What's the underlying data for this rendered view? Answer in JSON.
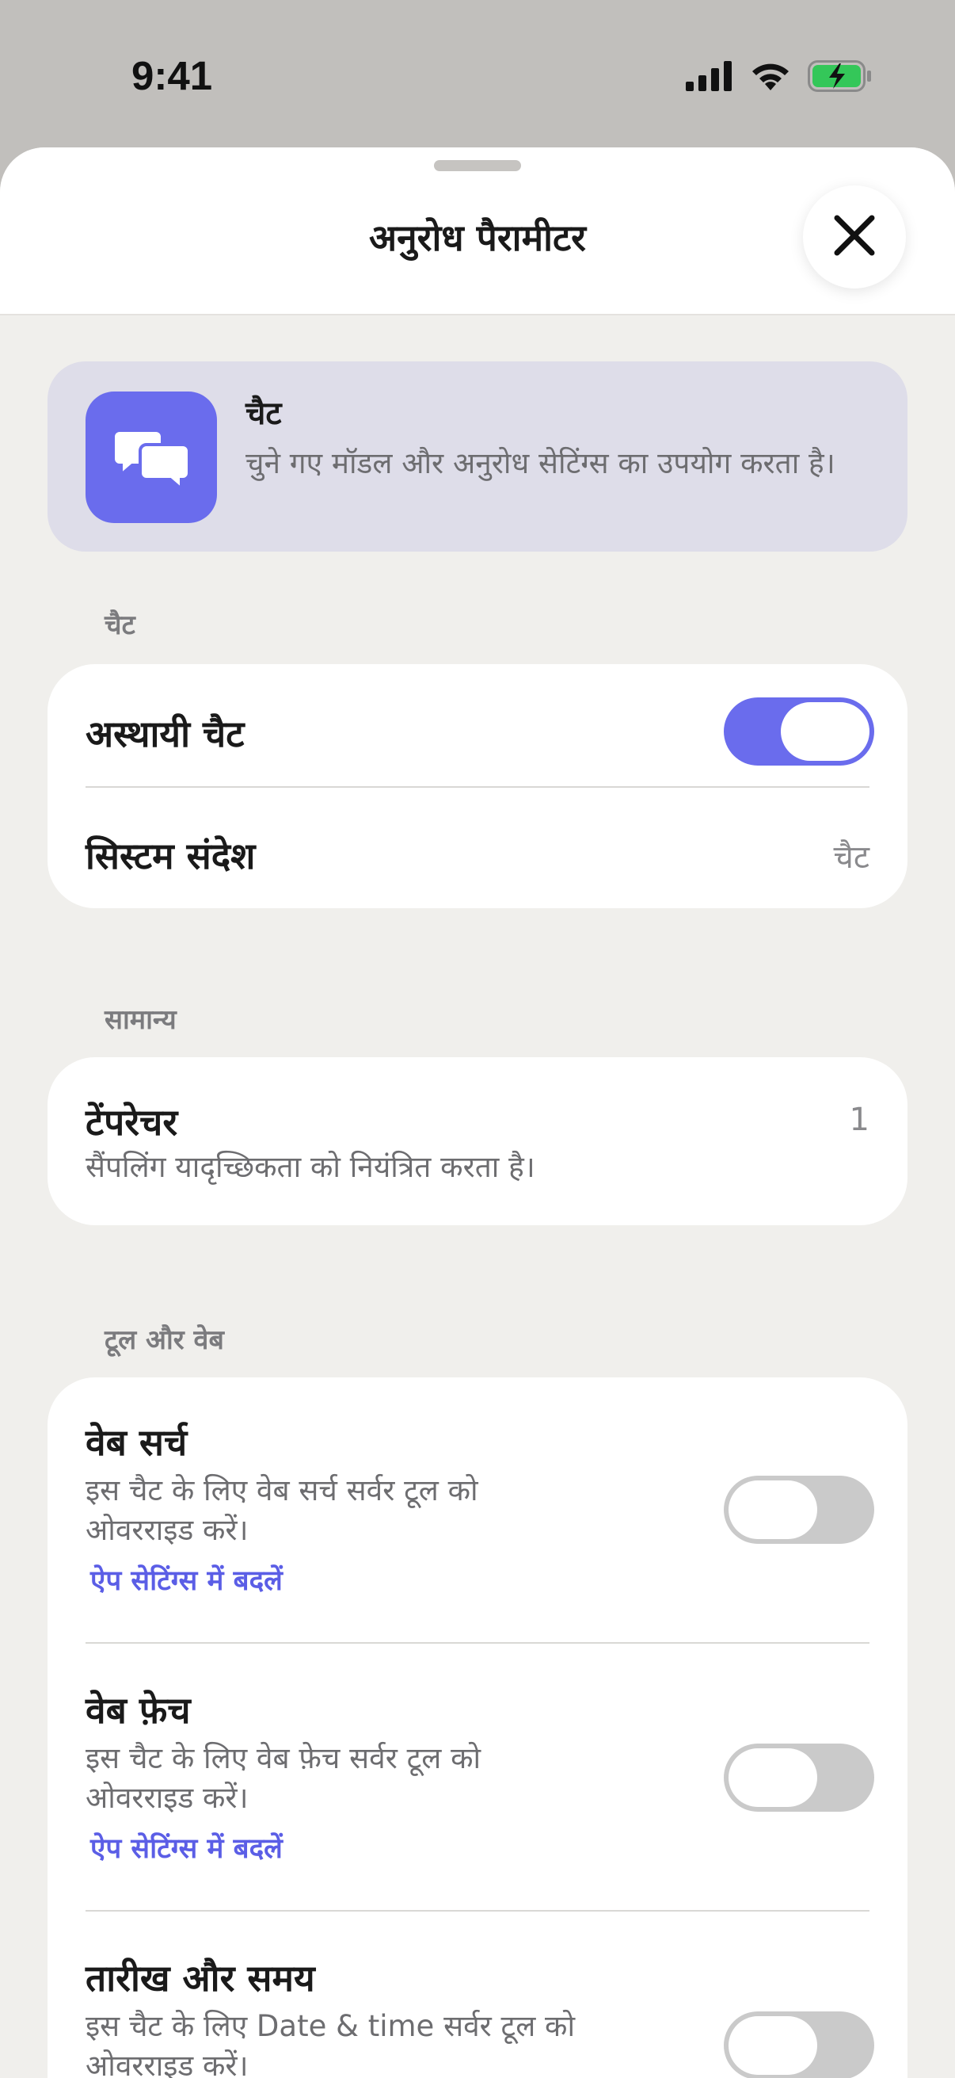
{
  "status_bar": {
    "time": "9:41",
    "icons": [
      "signal-icon",
      "wifi-icon",
      "battery-charging-icon"
    ]
  },
  "sheet": {
    "title": "अनुरोध पैरामीटर",
    "close_icon": "close-icon"
  },
  "mode_card": {
    "icon": "chat-bubbles-icon",
    "title": "चैट",
    "description": "चुने गए मॉडल और अनुरोध सेटिंग्स का उपयोग करता है।"
  },
  "sections": {
    "chat": {
      "label": "चैट",
      "temporary_chat": {
        "label": "अस्थायी चैट",
        "enabled": true
      },
      "system_message": {
        "label": "सिस्टम संदेश",
        "value": "चैट"
      }
    },
    "general": {
      "label": "सामान्य",
      "temperature": {
        "label": "टेंपरेचर",
        "description": "सैंपलिंग यादृच्छिकता को नियंत्रित करता है।",
        "value": "1"
      }
    },
    "tools": {
      "label": "टूल और वेब",
      "web_search": {
        "label": "वेब सर्च",
        "description": "इस चैट के लिए वेब सर्च सर्वर टूल को ओवरराइड करें।",
        "link": "ऐप सेटिंग्स में बदलें",
        "enabled": false
      },
      "web_fetch": {
        "label": "वेब फ़ेच",
        "description": "इस चैट के लिए वेब फ़ेच सर्वर टूल को ओवरराइड करें।",
        "link": "ऐप सेटिंग्स में बदलें",
        "enabled": false
      },
      "date_time": {
        "label": "तारीख और समय",
        "description": "इस चैट के लिए Date & time सर्वर टूल को ओवरराइड करें।",
        "enabled": false
      }
    }
  },
  "colors": {
    "accent": "#6a6ced",
    "link": "#5b5ee6",
    "battery": "#34c759"
  }
}
